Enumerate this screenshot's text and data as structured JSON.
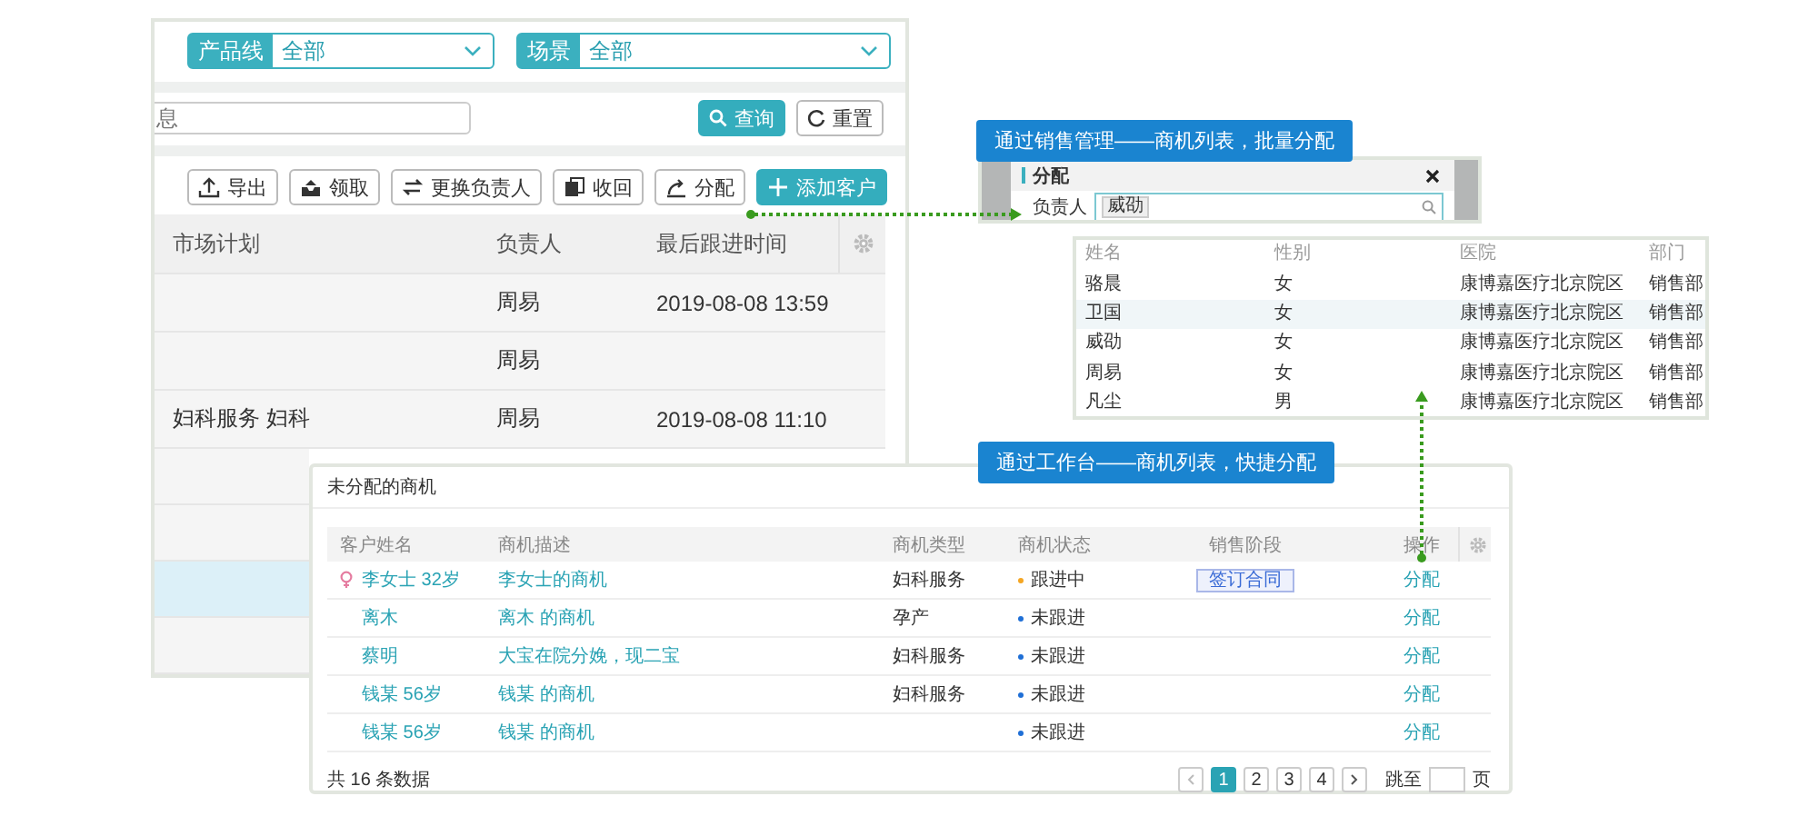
{
  "main_window": {
    "filters": [
      {
        "label": "产品线",
        "value": "全部"
      },
      {
        "label": "场景",
        "value": "全部"
      }
    ],
    "search": {
      "placeholder": "息"
    },
    "search_buttons": [
      {
        "label": "查询",
        "kind": "primary"
      },
      {
        "label": "重置",
        "kind": "default"
      }
    ],
    "toolbar": [
      {
        "label": "导出",
        "kind": "default"
      },
      {
        "label": "领取",
        "kind": "default"
      },
      {
        "label": "更换负责人",
        "kind": "default"
      },
      {
        "label": "收回",
        "kind": "default"
      },
      {
        "label": "分配",
        "kind": "default"
      },
      {
        "label": "添加客户",
        "kind": "primary"
      }
    ],
    "table": {
      "columns": [
        "市场计划",
        "负责人",
        "最后跟进时间"
      ],
      "rows": [
        {
          "owner": "周易",
          "last_followup": "2019-08-08 13:59",
          "selected": false
        },
        {
          "owner": "周易",
          "selected": false
        },
        {
          "market_plan": "妇科服务 妇科",
          "owner": "周易",
          "last_followup": "2019-08-08 11:10",
          "selected": false
        },
        {
          "selected": false
        },
        {
          "selected": false
        },
        {
          "selected": true
        },
        {
          "selected": false
        }
      ]
    }
  },
  "assign_dialog": {
    "callout": "通过销售管理——商机列表，批量分配",
    "title": "分配",
    "field_label": "负责人",
    "tag": "威劭"
  },
  "staff_dropdown": {
    "columns": [
      "姓名",
      "性别",
      "医院",
      "部门"
    ],
    "rows": [
      {
        "name": "骆晨",
        "gender": "女",
        "hospital": "康博嘉医疗北京院区",
        "department": "销售部",
        "selected": false
      },
      {
        "name": "卫国",
        "gender": "女",
        "hospital": "康博嘉医疗北京院区",
        "department": "销售部",
        "selected": true
      },
      {
        "name": "威劭",
        "gender": "女",
        "hospital": "康博嘉医疗北京院区",
        "department": "销售部",
        "selected": false
      },
      {
        "name": "周易",
        "gender": "女",
        "hospital": "康博嘉医疗北京院区",
        "department": "销售部",
        "selected": false
      },
      {
        "name": "凡尘",
        "gender": "男",
        "hospital": "康博嘉医疗北京院区",
        "department": "销售部",
        "selected": false
      }
    ]
  },
  "workbench": {
    "callout": "通过工作台——商机列表，快捷分配",
    "title": "未分配的商机",
    "columns": [
      "客户姓名",
      "商机描述",
      "商机类型",
      "商机状态",
      "销售阶段",
      "操作"
    ],
    "rows": [
      {
        "customer": "李女士  32岁",
        "marker": true,
        "description": "李女士的商机",
        "type": "妇科服务",
        "status": {
          "text": "跟进中",
          "color": "#f5a623"
        },
        "stage": "签订合同",
        "action": "分配"
      },
      {
        "customer": "离木",
        "marker": false,
        "description": "离木 的商机",
        "type": "孕产",
        "status": {
          "text": "未跟进",
          "color": "#1f6fd6"
        },
        "action": "分配"
      },
      {
        "customer": "蔡明",
        "marker": false,
        "description": "大宝在院分娩，现二宝",
        "type": "妇科服务",
        "status": {
          "text": "未跟进",
          "color": "#1f6fd6"
        },
        "action": "分配"
      },
      {
        "customer": "钱某  56岁",
        "marker": false,
        "description": "钱某 的商机",
        "type": "妇科服务",
        "status": {
          "text": "未跟进",
          "color": "#1f6fd6"
        },
        "action": "分配"
      },
      {
        "customer": "钱某  56岁",
        "marker": false,
        "description": "钱某 的商机",
        "status": {
          "text": "未跟进",
          "color": "#1f6fd6"
        },
        "action": "分配"
      }
    ],
    "total": "共 16 条数据",
    "pages": [
      {
        "label": "1",
        "selected": true
      },
      {
        "label": "2",
        "selected": false
      },
      {
        "label": "3",
        "selected": false
      },
      {
        "label": "4",
        "selected": false
      }
    ],
    "jump_label": "跳至",
    "page_unit": "页"
  }
}
